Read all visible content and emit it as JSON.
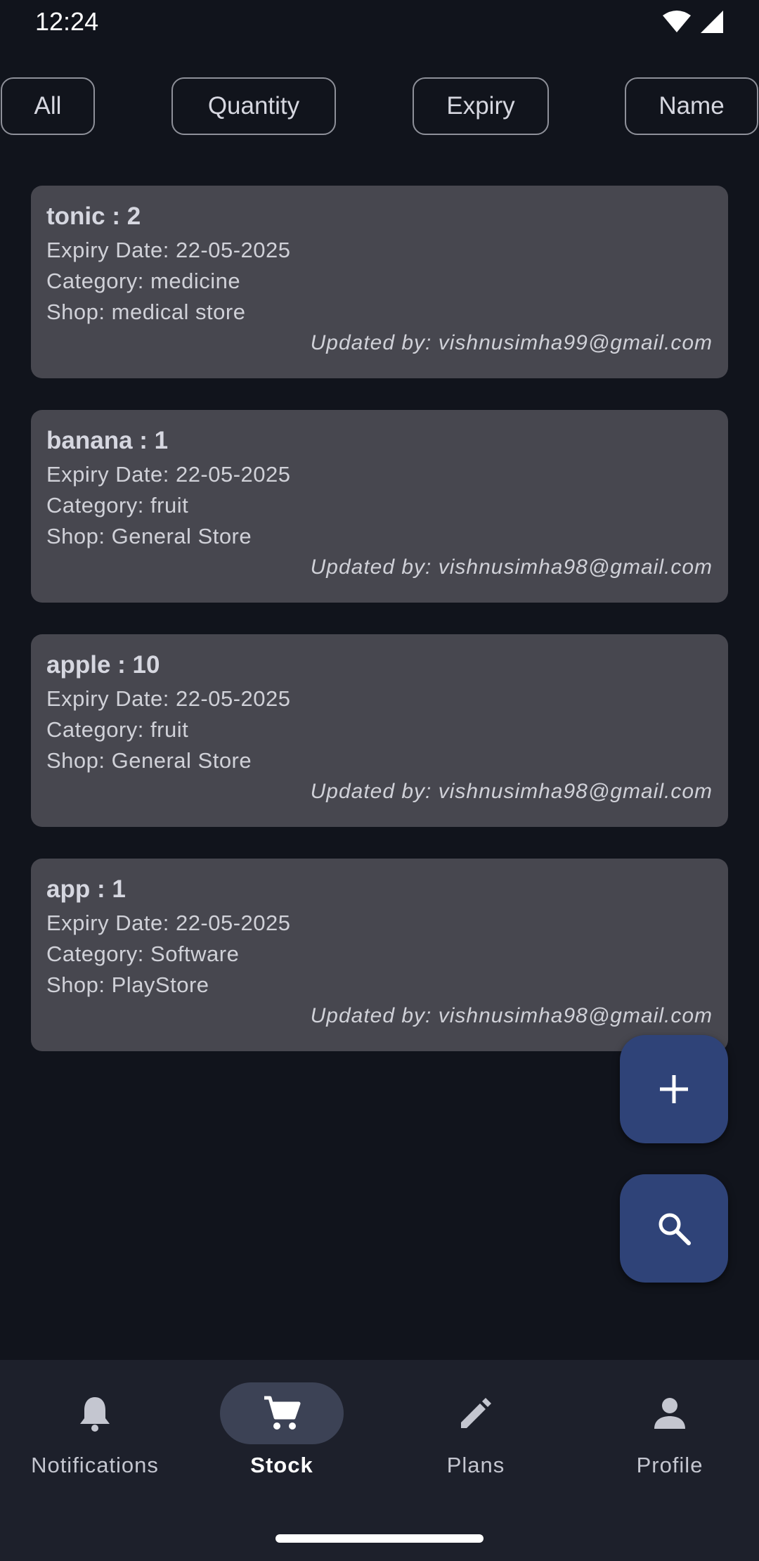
{
  "status_bar": {
    "time": "12:24"
  },
  "filters": [
    {
      "label": "All"
    },
    {
      "label": "Quantity"
    },
    {
      "label": "Expiry"
    },
    {
      "label": "Name"
    }
  ],
  "items": [
    {
      "title": "tonic : 2",
      "expiry": "Expiry Date: 22-05-2025",
      "category": "Category: medicine",
      "shop": "Shop: medical store",
      "updated": "Updated by: vishnusimha99@gmail.com"
    },
    {
      "title": "banana : 1",
      "expiry": "Expiry Date: 22-05-2025",
      "category": "Category: fruit",
      "shop": "Shop: General Store",
      "updated": "Updated by: vishnusimha98@gmail.com"
    },
    {
      "title": "apple : 10",
      "expiry": "Expiry Date: 22-05-2025",
      "category": "Category: fruit",
      "shop": "Shop: General Store",
      "updated": "Updated by: vishnusimha98@gmail.com"
    },
    {
      "title": "app : 1",
      "expiry": "Expiry Date: 22-05-2025",
      "category": "Category: Software",
      "shop": "Shop: PlayStore",
      "updated": "Updated by: vishnusimha98@gmail.com"
    }
  ],
  "fabs": {
    "add_icon": "plus-icon",
    "search_icon": "search-icon"
  },
  "bottom_nav": [
    {
      "label": "Notifications",
      "icon": "bell-icon",
      "active": false
    },
    {
      "label": "Stock",
      "icon": "cart-icon",
      "active": true
    },
    {
      "label": "Plans",
      "icon": "pencil-icon",
      "active": false
    },
    {
      "label": "Profile",
      "icon": "person-icon",
      "active": false
    }
  ],
  "colors": {
    "background": "#11141c",
    "card": "#47474f",
    "fab": "#2f4378",
    "nav": "#1d202b",
    "nav_active_pill": "#3c4255"
  }
}
